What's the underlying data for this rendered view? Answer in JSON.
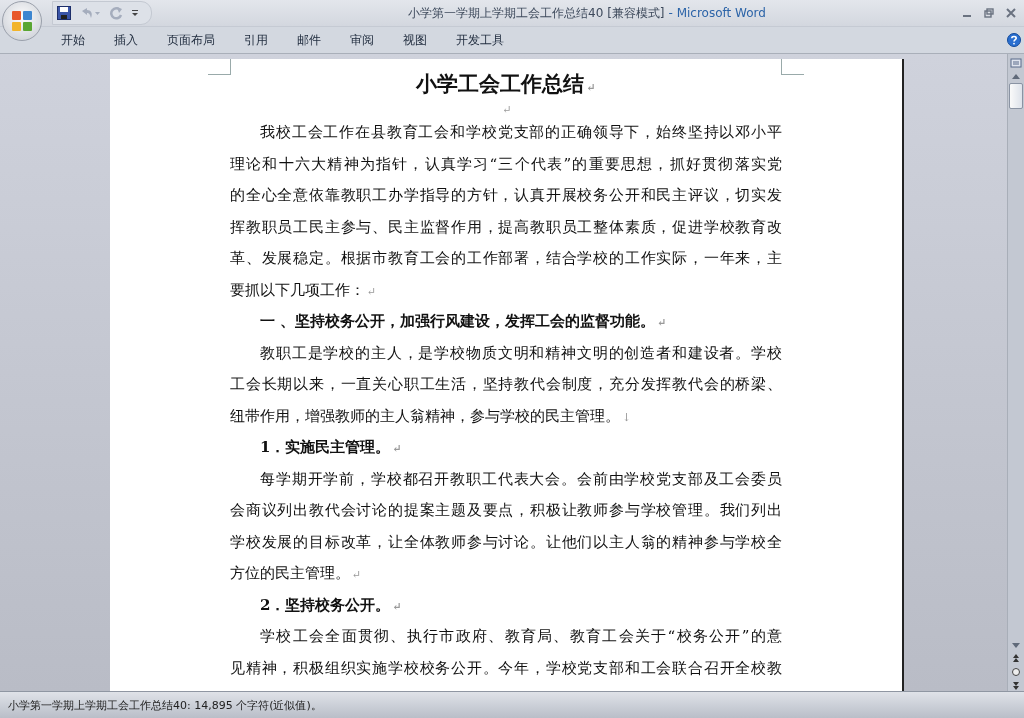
{
  "window": {
    "title": "小学第一学期上学期工会工作总结40 [兼容模式]",
    "app": "- Microsoft Word"
  },
  "tabs": [
    {
      "label": "开始",
      "selected": false
    },
    {
      "label": "插入",
      "selected": false
    },
    {
      "label": "页面布局",
      "selected": false
    },
    {
      "label": "引用",
      "selected": false
    },
    {
      "label": "邮件",
      "selected": false
    },
    {
      "label": "审阅",
      "selected": false
    },
    {
      "label": "视图",
      "selected": false
    },
    {
      "label": "开发工具",
      "selected": false
    }
  ],
  "document": {
    "paragraphs": [
      {
        "kind": "title",
        "lines": [
          "小学工会工作总结"
        ],
        "mark": "↵"
      },
      {
        "kind": "empty",
        "mark": "↵"
      },
      {
        "kind": "body",
        "lines": [
          "我校工会工作在县教育工会和学校党支部的正确领导下，始终坚持以邓小平",
          "理论和十六大精神为指针，认真学习“三个代表”的重要思想，抓好贯彻落实党",
          "的全心全意依靠教职工办学指导的方针，认真开展校务公开和民主评议，切实发",
          "挥教职员工民主参与、民主监督作用，提高教职员工整体素质，促进学校教育改",
          "革、发展稳定。根据市教育工会的工作部署，结合学校的工作实际，一年来，主",
          "要抓以下几项工作："
        ],
        "mark": "↵"
      },
      {
        "kind": "heading",
        "lines": [
          "一 、坚持校务公开，加强行风建设，发挥工会的监督功能。"
        ],
        "mark": "↵"
      },
      {
        "kind": "body",
        "lines": [
          "教职工是学校的主人，是学校物质文明和精神文明的创造者和建设者。学校",
          "工会长期以来，一直关心职工生活，坚持教代会制度，充分发挥教代会的桥梁、",
          "纽带作用，增强教师的主人翁精神，参与学校的民主管理。"
        ],
        "mark": "↓"
      },
      {
        "kind": "heading",
        "lines": [
          "1．实施民主管理。"
        ],
        "mark": "↵"
      },
      {
        "kind": "body",
        "lines": [
          "每学期开学前，学校都召开教职工代表大会。会前由学校党支部及工会委员",
          "会商议列出教代会讨论的提案主题及要点，积极让教师参与学校管理。我们列出",
          "学校发展的目标改革，让全体教师参与讨论。让他们以主人翁的精神参与学校全",
          "方位的民主管理。"
        ],
        "mark": "↵"
      },
      {
        "kind": "heading",
        "lines": [
          "2．坚持校务公开。"
        ],
        "mark": "↵"
      },
      {
        "kind": "cut",
        "lines": [
          "学校工会全面贯彻、执行市政府、教育局、教育工会关于“校务公开”的意",
          "见精神，积极组织实施学校校务公开。今年，学校党支部和工会联合召开全校教"
        ]
      }
    ]
  },
  "status_bar": "小学第一学期上学期工会工作总结40: 14,895 个字符(近似值)。"
}
